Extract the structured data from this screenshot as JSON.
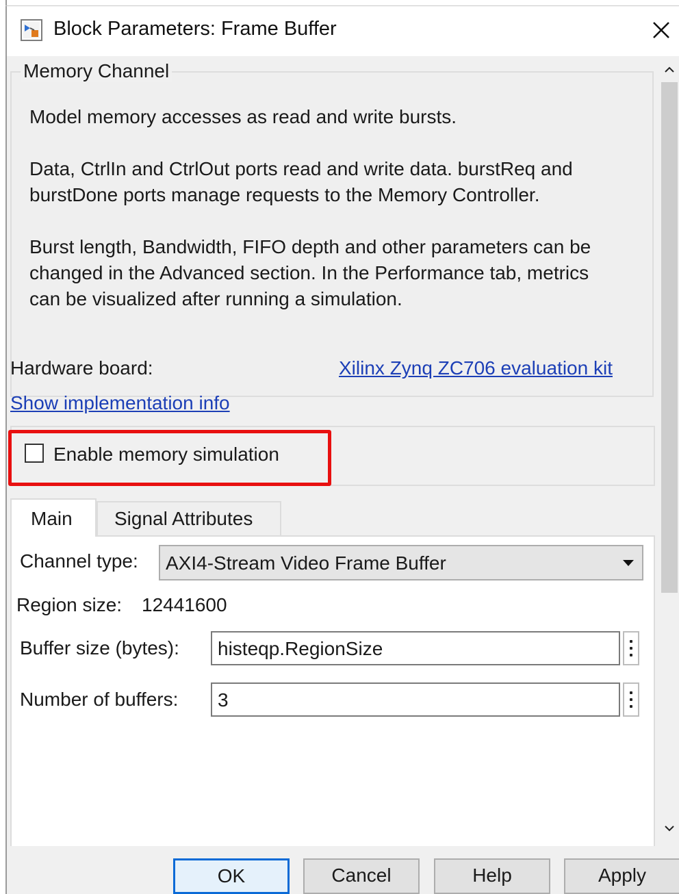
{
  "window": {
    "title": "Block Parameters: Frame Buffer"
  },
  "group": {
    "title": "Memory Channel",
    "description": [
      "Model memory accesses as read and write bursts.",
      "Data, CtrlIn and CtrlOut ports read and write data. burstReq and",
      "burstDone ports manage requests to the Memory Controller.",
      "Burst length, Bandwidth, FIFO depth and other parameters can be",
      "changed in the Advanced section. In the Performance tab, metrics",
      "can be visualized after running a simulation."
    ]
  },
  "hardware": {
    "label": "Hardware board:",
    "board_link": "Xilinx Zynq ZC706 evaluation kit",
    "impl_link": "Show implementation info"
  },
  "simulation": {
    "label": "Enable memory simulation",
    "checked": false
  },
  "tabs": [
    {
      "label": "Main",
      "active": true
    },
    {
      "label": "Signal Attributes",
      "active": false
    }
  ],
  "main": {
    "channel_type_label": "Channel type:",
    "channel_type_value": "AXI4-Stream Video Frame Buffer",
    "region_size_label": "Region size:",
    "region_size_value": "12441600",
    "buffer_size_label": "Buffer size (bytes):",
    "buffer_size_value": "histeqp.RegionSize",
    "num_buffers_label": "Number of buffers:",
    "num_buffers_value": "3"
  },
  "buttons": {
    "ok": "OK",
    "cancel": "Cancel",
    "help": "Help",
    "apply": "Apply"
  },
  "colors": {
    "link": "#1c3fb6",
    "highlight": "#e81010",
    "default_button_border": "#0a6ad6"
  }
}
